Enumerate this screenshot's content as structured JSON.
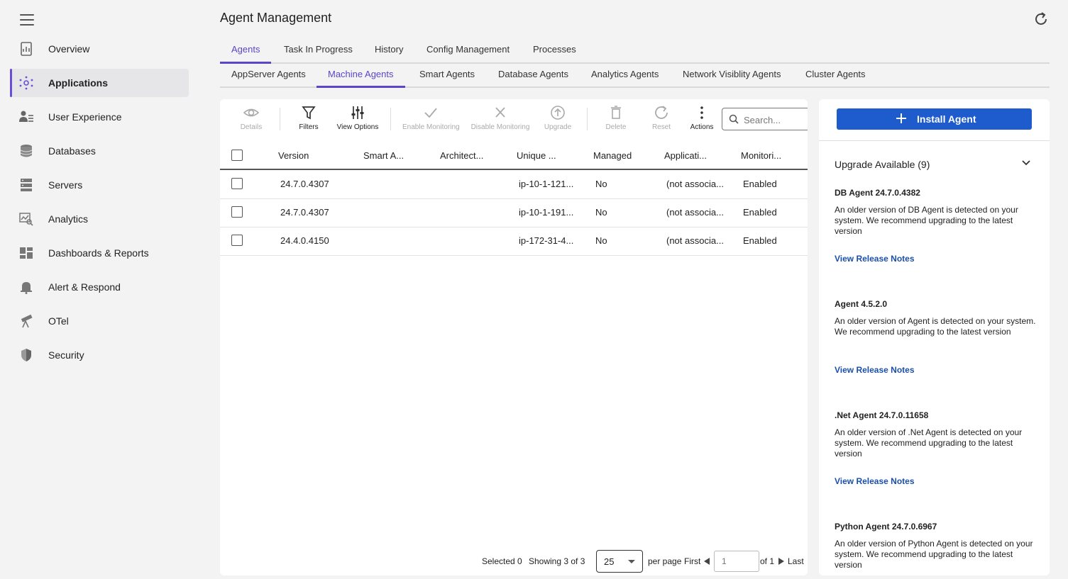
{
  "sidebar": {
    "items": [
      {
        "label": "Overview",
        "icon": "overview-icon"
      },
      {
        "label": "Applications",
        "icon": "applications-icon",
        "active": true
      },
      {
        "label": "User Experience",
        "icon": "user-experience-icon"
      },
      {
        "label": "Databases",
        "icon": "database-icon"
      },
      {
        "label": "Servers",
        "icon": "servers-icon"
      },
      {
        "label": "Analytics",
        "icon": "analytics-icon"
      },
      {
        "label": "Dashboards & Reports",
        "icon": "dashboards-icon"
      },
      {
        "label": "Alert & Respond",
        "icon": "bell-icon"
      },
      {
        "label": "OTel",
        "icon": "telescope-icon"
      },
      {
        "label": "Security",
        "icon": "shield-icon"
      }
    ]
  },
  "header": {
    "title": "Agent Management"
  },
  "tabs_primary": [
    "Agents",
    "Task In Progress",
    "History",
    "Config Management",
    "Processes"
  ],
  "tabs_secondary": [
    "AppServer Agents",
    "Machine Agents",
    "Smart Agents",
    "Database Agents",
    "Analytics Agents",
    "Network Visiblity Agents",
    "Cluster Agents"
  ],
  "toolbar": {
    "details": "Details",
    "filters": "Filters",
    "view_options": "View Options",
    "enable_monitoring": "Enable Monitoring",
    "disable_monitoring": "Disable Monitoring",
    "upgrade": "Upgrade",
    "delete": "Delete",
    "reset": "Reset",
    "actions": "Actions",
    "search_placeholder": "Search..."
  },
  "table": {
    "columns": [
      "Version",
      "Smart A...",
      "Architect...",
      "Unique ...",
      "Managed",
      "Applicati...",
      "Monitori..."
    ],
    "rows": [
      {
        "version": "24.7.0.4307",
        "unique": "ip-10-1-121...",
        "managed": "No",
        "application": "(not associa...",
        "monitoring": "Enabled"
      },
      {
        "version": "24.7.0.4307",
        "unique": "ip-10-1-191...",
        "managed": "No",
        "application": "(not associa...",
        "monitoring": "Enabled"
      },
      {
        "version": "24.4.0.4150",
        "unique": "ip-172-31-4...",
        "managed": "No",
        "application": "(not associa...",
        "monitoring": "Enabled"
      }
    ]
  },
  "pager": {
    "selected": "Selected 0",
    "showing": "Showing 3 of 3",
    "per_page_value": "25",
    "per_page_label": "per page",
    "first": "First",
    "page_placeholder": "1",
    "of": "of 1",
    "last": "Last"
  },
  "right_panel": {
    "install_label": "Install Agent",
    "upgrade_title": "Upgrade Available (9)",
    "items": [
      {
        "name": "DB Agent 24.7.0.4382",
        "desc": "An older version of DB Agent is detected on your system. We recommend upgrading to the latest version",
        "link": "View Release Notes"
      },
      {
        "name": "Agent 4.5.2.0",
        "desc": "An older version of Agent is detected on your system. We recommend upgrading to the latest version",
        "link": "View Release Notes"
      },
      {
        "name": ".Net Agent 24.7.0.11658",
        "desc": "An older version of .Net Agent is detected on your system. We recommend upgrading to the latest version",
        "link": "View Release Notes"
      },
      {
        "name": "Python Agent 24.7.0.6967",
        "desc": "An older version of Python Agent is detected on your system. We recommend upgrading to the latest version",
        "link": ""
      }
    ]
  },
  "colors": {
    "accent": "#5b45c9",
    "primary_button": "#1e5bcc",
    "link": "#1a4faa"
  }
}
